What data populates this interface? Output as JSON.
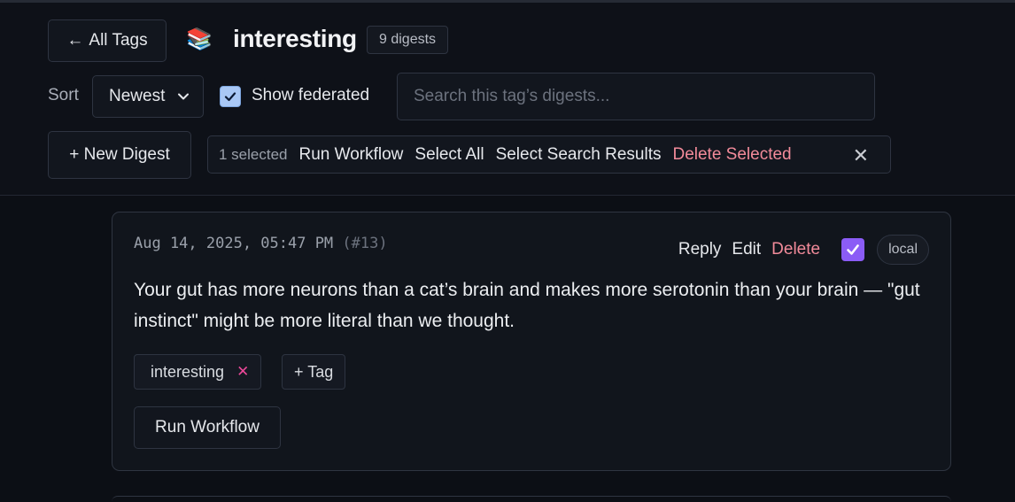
{
  "header": {
    "back_label": "All Tags",
    "tag_emoji": "📚",
    "tag_name": "interesting",
    "digest_count": "9 digests"
  },
  "controls": {
    "sort_label": "Sort",
    "sort_value": "Newest",
    "show_federated_label": "Show federated",
    "show_federated_checked": true,
    "search_placeholder": "Search this tag’s digests..."
  },
  "toolbar": {
    "new_digest_label": "+ New Digest",
    "selected_count": "1 selected",
    "run_workflow": "Run Workflow",
    "select_all": "Select All",
    "select_search_results": "Select Search Results",
    "delete_selected": "Delete Selected"
  },
  "digest": {
    "date": "Aug 14, 2025, 05:47 PM",
    "number": "(#13)",
    "actions": {
      "reply": "Reply",
      "edit": "Edit",
      "delete": "Delete"
    },
    "selected": true,
    "visibility": "local",
    "body": "Your gut has more neurons than a cat’s brain and makes more serotonin than your brain — \"gut instinct\" might be more literal than we thought.",
    "tags": [
      "interesting"
    ],
    "add_tag_label": "+ Tag",
    "run_workflow_label": "Run Workflow"
  },
  "colors": {
    "background": "#0c0f15",
    "danger": "#f28b9a",
    "checkbox_accent": "#8b5cf6",
    "tag_remove": "#ec4899"
  }
}
